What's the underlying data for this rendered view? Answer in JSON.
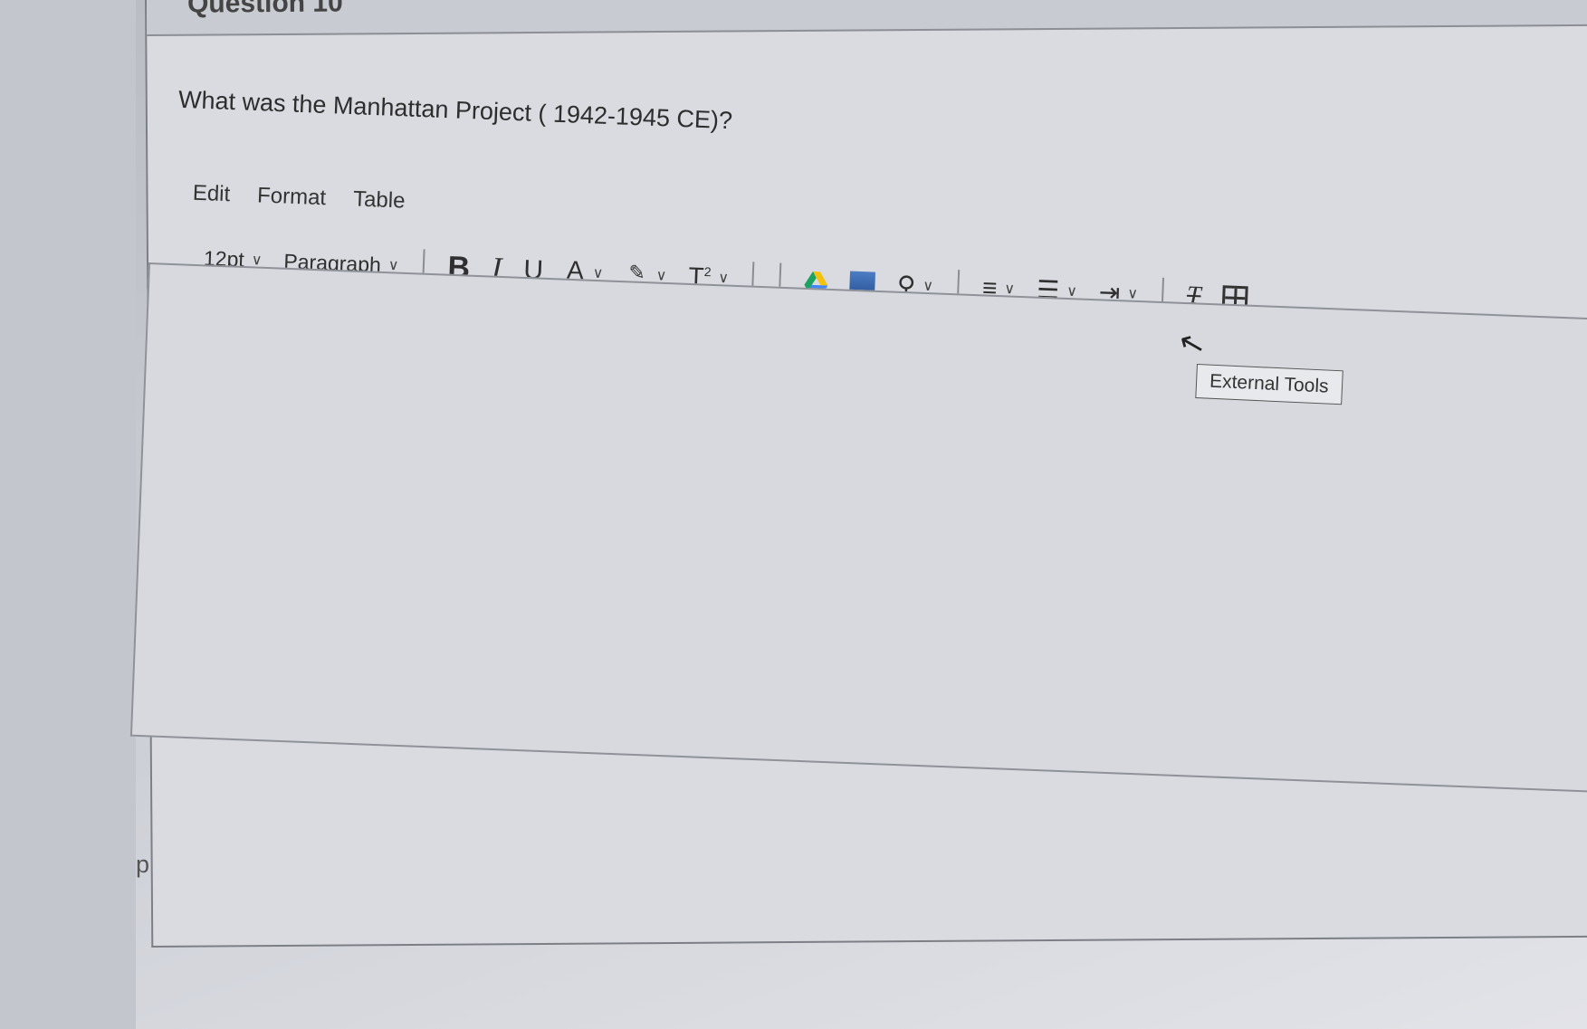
{
  "question": {
    "number_label": "Question 10",
    "prompt": "What was the Manhattan Project ( 1942-1945 CE)?"
  },
  "menu": {
    "items": [
      "Edit",
      "Format",
      "Table"
    ]
  },
  "toolbar": {
    "font_size": "12pt",
    "block_format": "Paragraph",
    "bold_label": "B",
    "italic_label": "I",
    "underline_label": "U",
    "font_color_label": "A",
    "superscript_label": "T",
    "superscript_mark": "2"
  },
  "tooltip": {
    "text": "External Tools"
  },
  "status_bar": {
    "element_path": "p"
  }
}
